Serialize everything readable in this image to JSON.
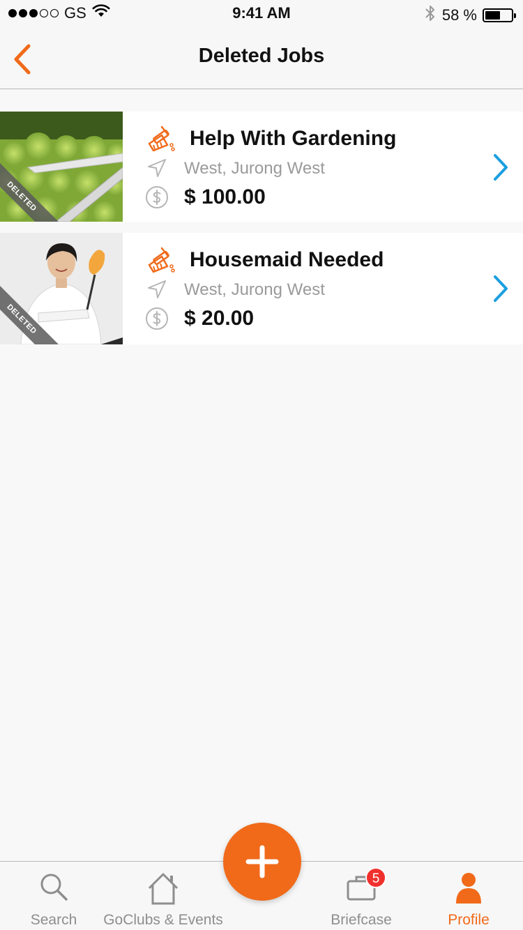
{
  "status_bar": {
    "carrier": "GS",
    "time": "9:41 AM",
    "battery_percent": "58 %",
    "battery_level": 0.58,
    "signal_filled": 3,
    "signal_total": 5
  },
  "nav": {
    "title": "Deleted Jobs",
    "back_icon": "chevron-left-icon"
  },
  "jobs": [
    {
      "title": "Help With Gardening",
      "location": "West, Jurong West",
      "price": "$ 100.00",
      "ribbon": "DELETED",
      "image": "hedge-shears-photo"
    },
    {
      "title": "Housemaid Needed",
      "location": "West, Jurong West",
      "price": "$ 20.00",
      "ribbon": "DELETED",
      "image": "housemaid-photo"
    }
  ],
  "tabs": [
    {
      "label": "Search",
      "icon": "search-icon",
      "active": false
    },
    {
      "label": "GoClubs & Events",
      "icon": "home-icon",
      "active": false
    },
    {
      "label": "Briefcase",
      "icon": "briefcase-icon",
      "active": false,
      "badge": "5"
    },
    {
      "label": "Profile",
      "icon": "profile-icon",
      "active": true
    }
  ],
  "fab": {
    "icon": "plus-icon"
  },
  "colors": {
    "accent": "#f06a1a",
    "chevron": "#1a9fe0",
    "badge": "#f0302d",
    "muted_text": "#9a9a9a"
  }
}
